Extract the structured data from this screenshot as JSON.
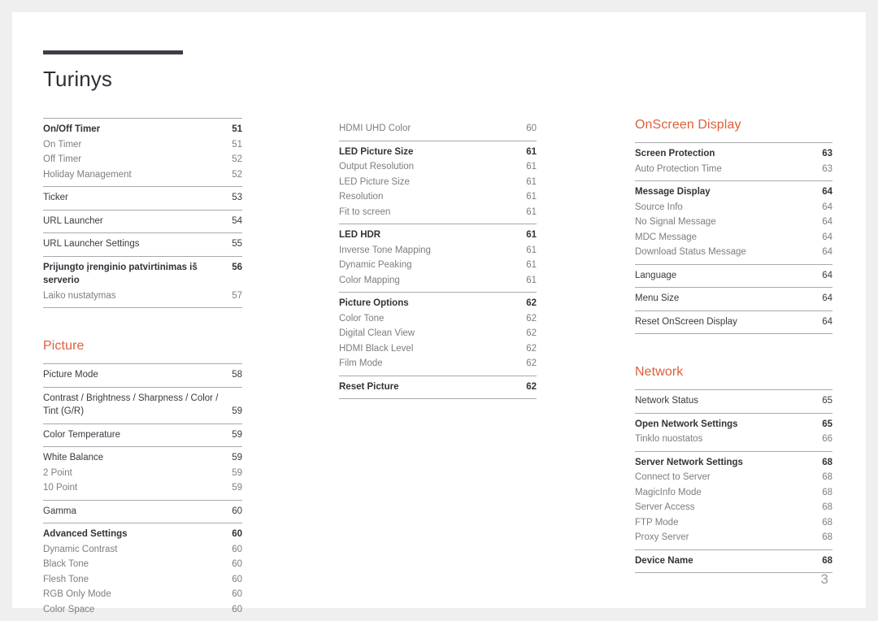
{
  "page": {
    "title": "Turinys",
    "number": "3",
    "accent_color": "#dd5f3a",
    "rule_color": "#3e3d4a"
  },
  "columns": [
    {
      "name": "column-1",
      "blocks": [
        {
          "kind": "group",
          "entries": [
            {
              "label": "On/Off Timer",
              "page": "51",
              "level": "primary"
            },
            {
              "label": "On Timer",
              "page": "51",
              "level": "sub"
            },
            {
              "label": "Off Timer",
              "page": "52",
              "level": "sub"
            },
            {
              "label": "Holiday Management",
              "page": "52",
              "level": "sub"
            }
          ]
        },
        {
          "kind": "group",
          "entries": [
            {
              "label": "Ticker",
              "page": "53",
              "level": "plain"
            }
          ]
        },
        {
          "kind": "group",
          "entries": [
            {
              "label": "URL Launcher",
              "page": "54",
              "level": "plain"
            }
          ]
        },
        {
          "kind": "group",
          "entries": [
            {
              "label": "URL Launcher Settings",
              "page": "55",
              "level": "plain"
            }
          ]
        },
        {
          "kind": "group",
          "last": true,
          "entries": [
            {
              "label": "Prijungto įrenginio patvirtinimas iš serverio",
              "page": "56",
              "level": "primary"
            },
            {
              "label": "Laiko nustatymas",
              "page": "57",
              "level": "sub"
            }
          ]
        },
        {
          "kind": "heading",
          "label": "Picture",
          "spaced": true
        },
        {
          "kind": "group",
          "entries": [
            {
              "label": "Picture Mode",
              "page": "58",
              "level": "plain"
            }
          ]
        },
        {
          "kind": "group",
          "entries": [
            {
              "label": "Contrast / Brightness / Sharpness / Color / Tint (G/R)",
              "page": "59",
              "level": "plain",
              "wrap": true
            }
          ]
        },
        {
          "kind": "group",
          "entries": [
            {
              "label": "Color Temperature",
              "page": "59",
              "level": "plain"
            }
          ]
        },
        {
          "kind": "group",
          "entries": [
            {
              "label": "White Balance",
              "page": "59",
              "level": "plain"
            },
            {
              "label": "2 Point",
              "page": "59",
              "level": "sub"
            },
            {
              "label": "10 Point",
              "page": "59",
              "level": "sub"
            }
          ]
        },
        {
          "kind": "group",
          "entries": [
            {
              "label": "Gamma",
              "page": "60",
              "level": "plain"
            }
          ]
        },
        {
          "kind": "group",
          "entries": [
            {
              "label": "Advanced Settings",
              "page": "60",
              "level": "primary"
            },
            {
              "label": "Dynamic Contrast",
              "page": "60",
              "level": "sub"
            },
            {
              "label": "Black Tone",
              "page": "60",
              "level": "sub"
            },
            {
              "label": "Flesh Tone",
              "page": "60",
              "level": "sub"
            },
            {
              "label": "RGB Only Mode",
              "page": "60",
              "level": "sub"
            },
            {
              "label": "Color Space",
              "page": "60",
              "level": "sub"
            }
          ]
        }
      ]
    },
    {
      "name": "column-2",
      "blocks": [
        {
          "kind": "group",
          "noRule": true,
          "entries": [
            {
              "label": "HDMI UHD Color",
              "page": "60",
              "level": "sub"
            }
          ]
        },
        {
          "kind": "group",
          "entries": [
            {
              "label": "LED Picture Size",
              "page": "61",
              "level": "primary"
            },
            {
              "label": "Output Resolution",
              "page": "61",
              "level": "sub"
            },
            {
              "label": "LED Picture Size",
              "page": "61",
              "level": "sub"
            },
            {
              "label": "Resolution",
              "page": "61",
              "level": "sub"
            },
            {
              "label": "Fit to screen",
              "page": "61",
              "level": "sub"
            }
          ]
        },
        {
          "kind": "group",
          "entries": [
            {
              "label": "LED HDR",
              "page": "61",
              "level": "primary"
            },
            {
              "label": "Inverse Tone Mapping",
              "page": "61",
              "level": "sub"
            },
            {
              "label": "Dynamic Peaking",
              "page": "61",
              "level": "sub"
            },
            {
              "label": "Color Mapping",
              "page": "61",
              "level": "sub"
            }
          ]
        },
        {
          "kind": "group",
          "entries": [
            {
              "label": "Picture Options",
              "page": "62",
              "level": "primary"
            },
            {
              "label": "Color Tone",
              "page": "62",
              "level": "sub"
            },
            {
              "label": "Digital Clean View",
              "page": "62",
              "level": "sub"
            },
            {
              "label": "HDMI Black Level",
              "page": "62",
              "level": "sub"
            },
            {
              "label": "Film Mode",
              "page": "62",
              "level": "sub"
            }
          ]
        },
        {
          "kind": "group",
          "last": true,
          "entries": [
            {
              "label": "Reset Picture",
              "page": "62",
              "level": "primary"
            }
          ]
        }
      ]
    },
    {
      "name": "column-3",
      "blocks": [
        {
          "kind": "heading",
          "label": "OnScreen Display",
          "spaced": false
        },
        {
          "kind": "group",
          "entries": [
            {
              "label": "Screen Protection",
              "page": "63",
              "level": "primary"
            },
            {
              "label": "Auto Protection Time",
              "page": "63",
              "level": "sub"
            }
          ]
        },
        {
          "kind": "group",
          "entries": [
            {
              "label": "Message Display",
              "page": "64",
              "level": "primary"
            },
            {
              "label": "Source Info",
              "page": "64",
              "level": "sub"
            },
            {
              "label": "No Signal Message",
              "page": "64",
              "level": "sub"
            },
            {
              "label": "MDC Message",
              "page": "64",
              "level": "sub"
            },
            {
              "label": "Download Status Message",
              "page": "64",
              "level": "sub"
            }
          ]
        },
        {
          "kind": "group",
          "entries": [
            {
              "label": "Language",
              "page": "64",
              "level": "plain"
            }
          ]
        },
        {
          "kind": "group",
          "entries": [
            {
              "label": "Menu Size",
              "page": "64",
              "level": "plain"
            }
          ]
        },
        {
          "kind": "group",
          "last": true,
          "entries": [
            {
              "label": "Reset OnScreen Display",
              "page": "64",
              "level": "plain"
            }
          ]
        },
        {
          "kind": "heading",
          "label": "Network",
          "spaced": true
        },
        {
          "kind": "group",
          "entries": [
            {
              "label": "Network Status",
              "page": "65",
              "level": "plain"
            }
          ]
        },
        {
          "kind": "group",
          "entries": [
            {
              "label": "Open Network Settings",
              "page": "65",
              "level": "primary"
            },
            {
              "label": "Tinklo nuostatos",
              "page": "66",
              "level": "sub"
            }
          ]
        },
        {
          "kind": "group",
          "entries": [
            {
              "label": "Server Network Settings",
              "page": "68",
              "level": "primary"
            },
            {
              "label": "Connect to Server",
              "page": "68",
              "level": "sub"
            },
            {
              "label": "MagicInfo Mode",
              "page": "68",
              "level": "sub"
            },
            {
              "label": "Server Access",
              "page": "68",
              "level": "sub"
            },
            {
              "label": "FTP Mode",
              "page": "68",
              "level": "sub"
            },
            {
              "label": "Proxy Server",
              "page": "68",
              "level": "sub"
            }
          ]
        },
        {
          "kind": "group",
          "last": true,
          "entries": [
            {
              "label": "Device Name",
              "page": "68",
              "level": "primary"
            }
          ]
        }
      ]
    }
  ]
}
